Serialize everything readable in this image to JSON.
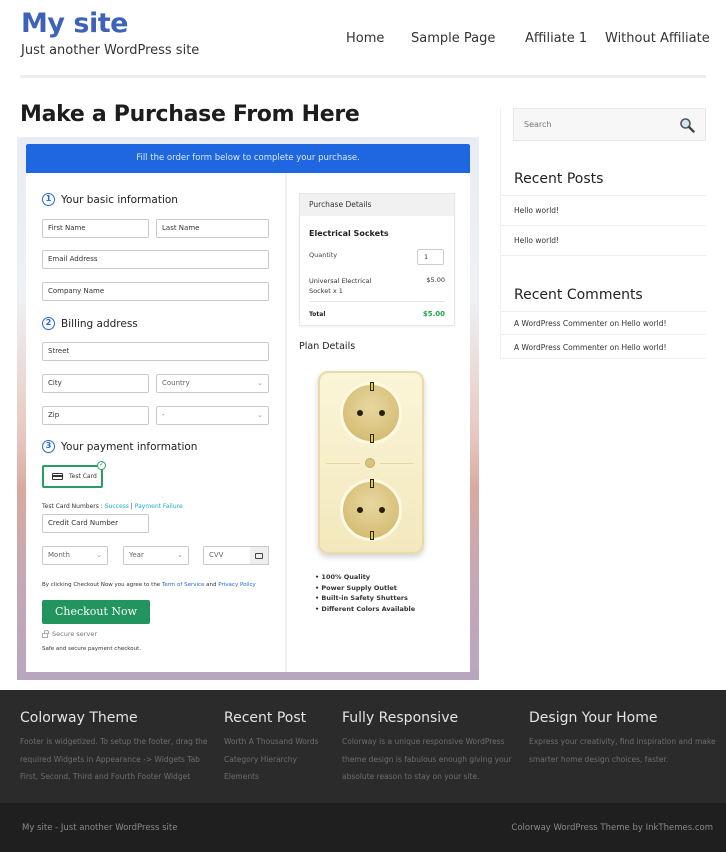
{
  "header": {
    "site_title": "My site",
    "tagline": "Just another WordPress site",
    "nav": [
      {
        "label": "Home"
      },
      {
        "label": "Sample Page"
      },
      {
        "label": "Affiliate 1"
      },
      {
        "label": "Without Affiliate"
      }
    ]
  },
  "main": {
    "page_title": "Make a Purchase From Here",
    "checkout": {
      "banner": "Fill the order form below to complete your purchase.",
      "steps": [
        {
          "num": "1",
          "title": "Your basic information"
        },
        {
          "num": "2",
          "title": "Billing address"
        },
        {
          "num": "3",
          "title": "Your payment information"
        }
      ],
      "fields": {
        "first_name": "First Name",
        "last_name": "Last Name",
        "email": "Email Address",
        "company": "Company Name",
        "street": "Street",
        "city": "City",
        "country": "Country",
        "zip": "Zip",
        "state": "-",
        "card_number": "Credit Card Number",
        "month": "Month",
        "year": "Year",
        "cvv": "CVV"
      },
      "payment_option": "Test Card",
      "test_cards_label": "Test Card Numbers : ",
      "test_success": "Success",
      "test_separator": " | ",
      "test_failure": "Payment Failure",
      "terms_prefix": "By clicking Checkout Now you agree to the ",
      "terms_link": "Term of Service",
      "terms_and": " and ",
      "privacy_link": "Privacy Policy",
      "checkout_button": "Checkout Now",
      "secure_server": "Secure server",
      "safe_text": "Safe and secure payment checkout."
    },
    "purchase_details": {
      "header": "Purchase Details",
      "product": "Electrical Sockets",
      "quantity_label": "Quantity",
      "quantity": "1",
      "item": "Universal Electrical Socket x 1",
      "item_price": "$5.00",
      "total_label": "Total",
      "total": "$5.00",
      "total_color": "#22a84a"
    },
    "plan_details": {
      "title": "Plan Details",
      "features": [
        "100% Quality",
        "Power Supply Outlet",
        "Built-in Safety Shutters",
        "Different Colors Available"
      ]
    }
  },
  "sidebar": {
    "search_placeholder": "Search",
    "recent_posts_title": "Recent Posts",
    "recent_posts": [
      "Hello world!",
      "Hello world!"
    ],
    "recent_comments_title": "Recent Comments",
    "recent_comments": [
      "A WordPress Commenter on Hello world!",
      "A WordPress Commenter on Hello world!"
    ]
  },
  "footer": {
    "columns": [
      {
        "title": "Colorway Theme",
        "lines": [
          "Footer is widgetized. To setup the footer, drag the",
          "required Widgets in Appearance -> Widgets Tab",
          "First, Second, Third and Fourth Footer Widget"
        ]
      },
      {
        "title": "Recent Post",
        "links": [
          "Worth A Thousand Words",
          "Category Hierarchy",
          "Elements"
        ]
      },
      {
        "title": "Fully Responsive",
        "lines": [
          "Colorway is a unique responsive WordPress",
          "theme design is fabulous enough giving your",
          "absolute reason to stay on your site."
        ]
      },
      {
        "title": "Design Your Home",
        "lines": [
          "Express your creativity, find inspiration and make",
          "smarter home design choices, faster."
        ]
      }
    ],
    "bottom_left": "My site - Just another WordPress site",
    "bottom_right": "Colorway WordPress Theme by InkThemes.com"
  },
  "colors": {
    "brand": "#3d63b8",
    "banner": "#1e67e0",
    "checkout_button": "#22955e",
    "footer_bg": "#2b2b2b"
  }
}
